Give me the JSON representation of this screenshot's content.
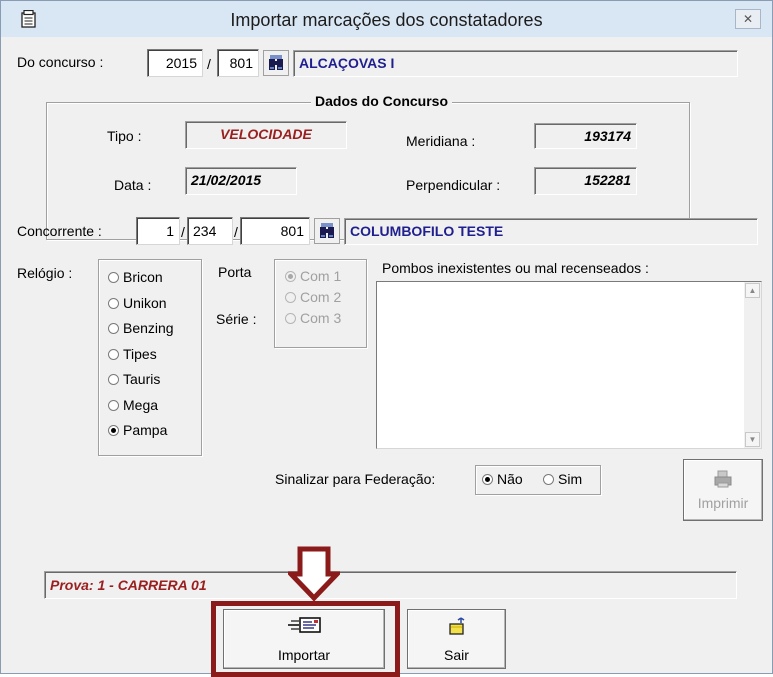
{
  "window": {
    "title": "Importar marcações dos constatadores",
    "close_glyph": "✕"
  },
  "concurso": {
    "label": "Do concurso :",
    "year": "2015",
    "separator": "/",
    "number": "801",
    "name": "ALCAÇOVAS I"
  },
  "dados": {
    "title": "Dados do Concurso",
    "tipo_label": "Tipo :",
    "tipo_value": "VELOCIDADE",
    "data_label": "Data :",
    "data_value": "21/02/2015",
    "meridiana_label": "Meridiana :",
    "meridiana_value": "193174",
    "perpendicular_label": "Perpendicular :",
    "perpendicular_value": "152281"
  },
  "concorrente": {
    "label": "Concorrente :",
    "field1": "1",
    "sep1": "/",
    "field2": "234",
    "sep2": "/",
    "field3": "801",
    "name": "COLUMBOFILO TESTE"
  },
  "relogio": {
    "label": "Relógio :",
    "options": [
      "Bricon",
      "Unikon",
      "Benzing",
      "Tipes",
      "Tauris",
      "Mega",
      "Pampa"
    ],
    "selected": "Pampa"
  },
  "porta": {
    "porta_label": "Porta",
    "serie_label": "Série :",
    "options": [
      "Com 1",
      "Com 2",
      "Com 3"
    ],
    "selected": "Com 1"
  },
  "pombos": {
    "label": "Pombos inexistentes ou mal recenseados :"
  },
  "federacao": {
    "label": "Sinalizar para Federação:",
    "options": [
      "Não",
      "Sim"
    ],
    "selected": "Não"
  },
  "imprimir": {
    "label": "Imprimir"
  },
  "prova": {
    "text": "Prova:  1 - CARRERA 01"
  },
  "buttons": {
    "importar": "Importar",
    "sair": "Sair"
  },
  "colors": {
    "highlight": "#8b1a1a",
    "title_bar": "#d9e6f4",
    "face": "#f0f0f0"
  }
}
